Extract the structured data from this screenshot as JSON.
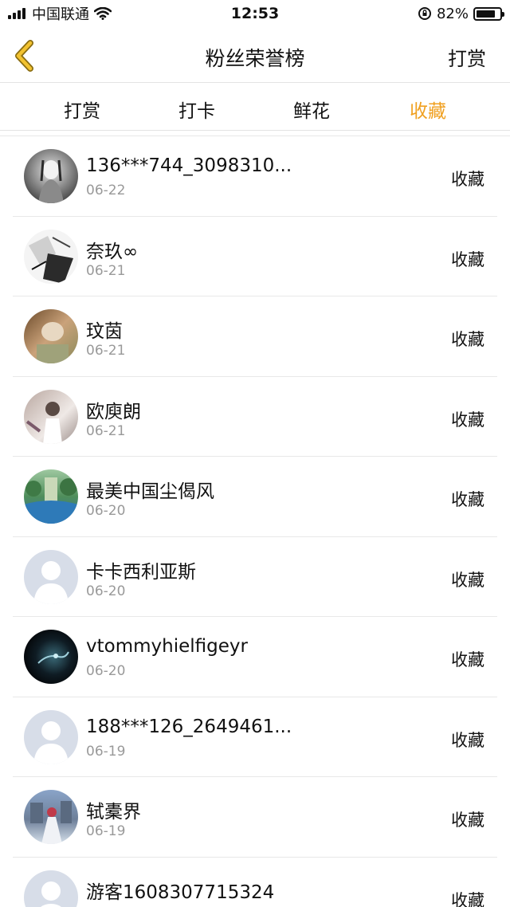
{
  "status_bar": {
    "carrier": "中国联通",
    "time": "12:53",
    "battery": "82%",
    "battery_level": 0.82
  },
  "header": {
    "title": "粉丝荣誉榜",
    "action_label": "打赏"
  },
  "tabs": [
    {
      "label": "打赏",
      "active": false
    },
    {
      "label": "打卡",
      "active": false
    },
    {
      "label": "鲜花",
      "active": false
    },
    {
      "label": "收藏",
      "active": true
    }
  ],
  "accent_color": "#f0a020",
  "list": [
    {
      "name": "136***744_3098310...",
      "date": "06-22",
      "type": "收藏",
      "avatar": "photo-gray-figure"
    },
    {
      "name": "奈玖∞",
      "date": "06-21",
      "type": "收藏",
      "avatar": "photo-sketch"
    },
    {
      "name": "玟茵",
      "date": "06-21",
      "type": "收藏",
      "avatar": "photo-warm"
    },
    {
      "name": "欧庾朗",
      "date": "06-21",
      "type": "收藏",
      "avatar": "photo-pale"
    },
    {
      "name": "最美中国尘偈风",
      "date": "06-20",
      "type": "收藏",
      "avatar": "photo-green"
    },
    {
      "name": "卡卡西利亚斯",
      "date": "06-20",
      "type": "收藏",
      "avatar": "default-avatar"
    },
    {
      "name": "vtommyhielfigeyr",
      "date": "06-20",
      "type": "收藏",
      "avatar": "photo-dark"
    },
    {
      "name": "188***126_2649461...",
      "date": "06-19",
      "type": "收藏",
      "avatar": "default-avatar"
    },
    {
      "name": "轼橐界",
      "date": "06-19",
      "type": "收藏",
      "avatar": "photo-castle"
    },
    {
      "name": "游客1608307715324",
      "date": "",
      "type": "收藏",
      "avatar": "default-avatar"
    }
  ]
}
